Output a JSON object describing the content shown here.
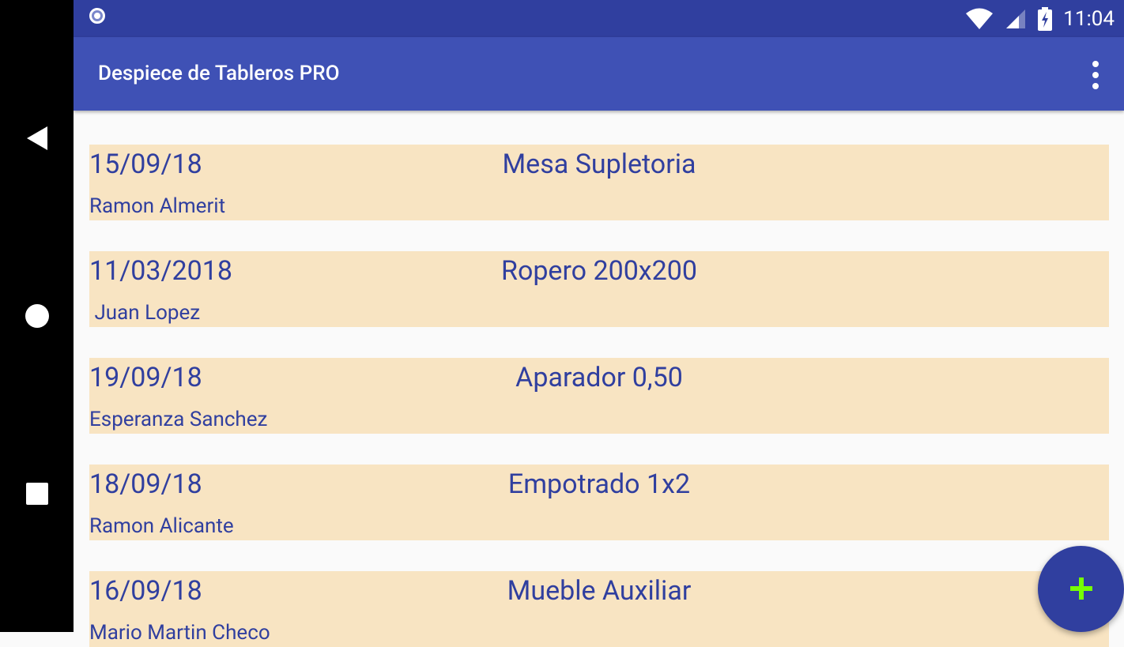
{
  "status_bar": {
    "time": "11:04"
  },
  "app_bar": {
    "title": "Despiece de Tableros PRO"
  },
  "items": [
    {
      "date": "15/09/18",
      "name": "Mesa Supletoria",
      "client": "Ramon Almerit"
    },
    {
      "date": "11/03/2018",
      "name": "Ropero 200x200",
      "client": " Juan Lopez"
    },
    {
      "date": "19/09/18",
      "name": "Aparador 0,50",
      "client": "Esperanza Sanchez"
    },
    {
      "date": "18/09/18",
      "name": "Empotrado 1x2",
      "client": "Ramon Alicante"
    },
    {
      "date": "16/09/18",
      "name": "Mueble Auxiliar",
      "client": "Mario Martin Checo"
    }
  ],
  "colors": {
    "primary": "#3f51b5",
    "primary_dark": "#303f9f",
    "row_background": "#f8e4c2",
    "fab_plus": "#76ff03"
  }
}
